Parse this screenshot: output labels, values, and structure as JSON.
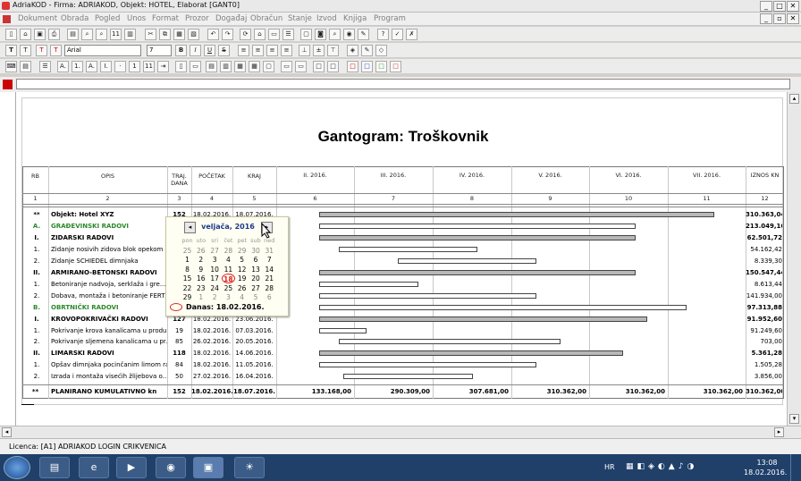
{
  "window": {
    "title": "AdriaKOD - Firma: ADRIAKOD,  Objekt: HOTEL, Elaborat [GANT0]"
  },
  "menu": [
    "Dokument",
    "Obrada",
    "Pogled",
    "Unos",
    "Format",
    "Prozor",
    "Događaj",
    "Obračun",
    "Stanje",
    "Izvod",
    "Knjiga",
    "Program"
  ],
  "font": {
    "name": "Arial",
    "size": "7"
  },
  "status": {
    "licence": "Licenca: [A1] ADRIAKOD LOGIN CRIKVENICA"
  },
  "taskbar": {
    "lang": "HR",
    "time": "13:08",
    "date": "18.02.2016."
  },
  "gantt": {
    "title": "Gantogram: Troškovnik",
    "headers": {
      "rb": "RB",
      "opis": "OPIS",
      "traj": "TRAJ. DANA",
      "pocetak": "POČETAK",
      "kraj": "KRAJ",
      "months": [
        "II. 2016.",
        "III. 2016.",
        "IV. 2016.",
        "V. 2016.",
        "VI. 2016.",
        "VII. 2016."
      ],
      "iznos": "IZNOS KN"
    },
    "colnums": [
      "1",
      "2",
      "3",
      "4",
      "5",
      "6",
      "7",
      "8",
      "9",
      "10",
      "11",
      "12"
    ],
    "rows": [
      {
        "rb": "**",
        "opis": "Objekt: Hotel XYZ",
        "traj": "152",
        "pocetak": "18.02.2016.",
        "kraj": "18.07.2016.",
        "iznos": "310.363,04",
        "bold": true,
        "bar": [
          0.0,
          1.0
        ],
        "grey": true
      },
      {
        "rb": "A.",
        "opis": "GRAĐEVINSKI RADOVI",
        "traj": "",
        "pocetak": "",
        "kraj": "",
        "iznos": "213.049,16",
        "bold": true,
        "green": true,
        "bar": [
          0.0,
          0.8
        ],
        "grey": false
      },
      {
        "rb": "I.",
        "opis": "ZIDARSKI RADOVI",
        "traj": "",
        "pocetak": "",
        "kraj": "",
        "iznos": "62.501,72",
        "bold": true,
        "bar": [
          0.0,
          0.8
        ],
        "grey": true
      },
      {
        "rb": "1.",
        "opis": "Zidanje nosivih zidova blok opekom ...",
        "traj": "",
        "pocetak": "",
        "kraj": "",
        "iznos": "54.162,42",
        "bar": [
          0.05,
          0.4
        ],
        "grey": false
      },
      {
        "rb": "2.",
        "opis": "Zidanje SCHIEDEL dimnjaka",
        "traj": "",
        "pocetak": "",
        "kraj": "",
        "iznos": "8.339,30",
        "bar": [
          0.2,
          0.55
        ],
        "grey": false
      },
      {
        "rb": "II.",
        "opis": "ARMIRANO-BETONSKI RADOVI",
        "traj": "",
        "pocetak": "",
        "kraj": "",
        "iznos": "150.547,44",
        "bold": true,
        "bar": [
          0.0,
          0.8
        ],
        "grey": true
      },
      {
        "rb": "1.",
        "opis": "Betoniranje nadvoja, serklaža i gre...",
        "traj": "",
        "pocetak": "",
        "kraj": "",
        "iznos": "8.613,44",
        "bar": [
          0.0,
          0.25
        ],
        "grey": false
      },
      {
        "rb": "2.",
        "opis": "Dobava, montaža i betoniranje FERT ...",
        "traj": "",
        "pocetak": "",
        "kraj": "",
        "iznos": "141.934,00",
        "bar": [
          0.0,
          0.55
        ],
        "grey": false
      },
      {
        "rb": "B.",
        "opis": "OBRTNIČKI RADOVI",
        "traj": "",
        "pocetak": "",
        "kraj": "",
        "iznos": "97.313,88",
        "bold": true,
        "green": true,
        "bar": [
          0.0,
          0.93
        ],
        "grey": false
      },
      {
        "rb": "I.",
        "opis": "KROVOPOKRIVAČKI RADOVI",
        "traj": "127",
        "pocetak": "18.02.2016.",
        "kraj": "23.06.2016.",
        "iznos": "91.952,60",
        "bold": true,
        "bar": [
          0.0,
          0.83
        ],
        "grey": true
      },
      {
        "rb": "1.",
        "opis": "Pokrivanje krova kanalicama u produ...",
        "traj": "19",
        "pocetak": "18.02.2016.",
        "kraj": "07.03.2016.",
        "iznos": "91.249,60",
        "bar": [
          0.0,
          0.12
        ],
        "grey": false
      },
      {
        "rb": "2.",
        "opis": "Pokrivanje sljemena kanalicama u pr...",
        "traj": "85",
        "pocetak": "26.02.2016.",
        "kraj": "20.05.2016.",
        "iznos": "703,00",
        "bar": [
          0.05,
          0.61
        ],
        "grey": false
      },
      {
        "rb": "II.",
        "opis": "LIMARSKI RADOVI",
        "traj": "118",
        "pocetak": "18.02.2016.",
        "kraj": "14.06.2016.",
        "iznos": "5.361,28",
        "bold": true,
        "bar": [
          0.0,
          0.77
        ],
        "grey": true
      },
      {
        "rb": "1.",
        "opis": "Opšav dimnjaka pocinčanim limom raz...",
        "traj": "84",
        "pocetak": "18.02.2016.",
        "kraj": "11.05.2016.",
        "iznos": "1.505,28",
        "bar": [
          0.0,
          0.55
        ],
        "grey": false
      },
      {
        "rb": "2.",
        "opis": "Izrada i montaža visećih žlijebova o...",
        "traj": "50",
        "pocetak": "27.02.2016.",
        "kraj": "16.04.2016.",
        "iznos": "3.856,00",
        "bar": [
          0.06,
          0.39
        ],
        "grey": false
      }
    ],
    "total": {
      "rb": "**",
      "opis": "PLANIRANO KUMULATIVNO kn",
      "traj": "152",
      "pocetak": "18.02.2016.",
      "kraj": "18.07.2016.",
      "months": [
        "133.168,00",
        "290.309,00",
        "307.681,00",
        "310.362,00",
        "310.362,00",
        "310.362,00"
      ],
      "iznos": "310.362,00"
    }
  },
  "calendar": {
    "header": "veljača, 2016",
    "dow": [
      "pon",
      "uto",
      "sri",
      "čet",
      "pet",
      "sub",
      "ned"
    ],
    "weeks": [
      [
        "25",
        "26",
        "27",
        "28",
        "29",
        "30",
        "31"
      ],
      [
        "1",
        "2",
        "3",
        "4",
        "5",
        "6",
        "7"
      ],
      [
        "8",
        "9",
        "10",
        "11",
        "12",
        "13",
        "14"
      ],
      [
        "15",
        "16",
        "17",
        "18",
        "19",
        "20",
        "21"
      ],
      [
        "22",
        "23",
        "24",
        "25",
        "26",
        "27",
        "28"
      ],
      [
        "29",
        "1",
        "2",
        "3",
        "4",
        "5",
        "6"
      ]
    ],
    "today_label": "Danas: 18.02.2016."
  }
}
